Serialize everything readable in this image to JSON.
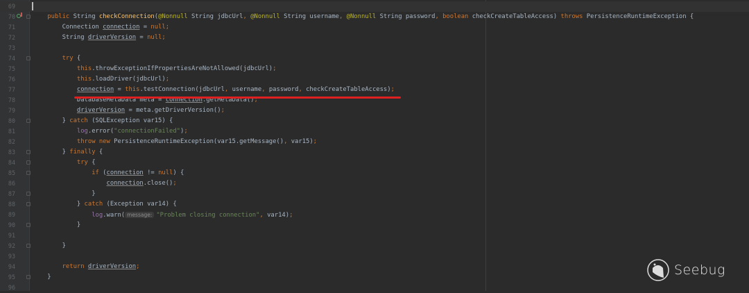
{
  "editor": {
    "current_line": 69,
    "colors": {
      "background": "#2b2b2b",
      "keyword": "#cc7832",
      "annotation": "#bbb529",
      "string": "#6a8759",
      "field": "#9876aa",
      "method_decl": "#ffc66d",
      "plain": "#a9b7c6",
      "highlight_underline": "#e02020"
    },
    "highlighted_line": 77,
    "lines": [
      {
        "n": "69",
        "tokens": []
      },
      {
        "n": "70",
        "fold": true,
        "tokens": [
          [
            "",
            "    "
          ],
          [
            "kw",
            "public "
          ],
          [
            "",
            "String "
          ],
          [
            "fn",
            "checkConnection"
          ],
          [
            "",
            "("
          ],
          [
            "ann",
            "@Nonnull "
          ],
          [
            "",
            "String jdbcUrl"
          ],
          [
            "kw",
            ", "
          ],
          [
            "ann",
            "@Nonnull "
          ],
          [
            "",
            "String username"
          ],
          [
            "kw",
            ", "
          ],
          [
            "ann",
            "@Nonnull "
          ],
          [
            "",
            "String password"
          ],
          [
            "kw",
            ", boolean "
          ],
          [
            "",
            "checkCreateTableAccess) "
          ],
          [
            "kw",
            "throws "
          ],
          [
            "",
            "PersistenceRuntimeException {"
          ]
        ]
      },
      {
        "n": "71",
        "tokens": [
          [
            "",
            "        Connection "
          ],
          [
            "u",
            "connection"
          ],
          [
            "",
            " = "
          ],
          [
            "kw",
            "null;"
          ]
        ]
      },
      {
        "n": "72",
        "tokens": [
          [
            "",
            "        String "
          ],
          [
            "u",
            "driverVersion"
          ],
          [
            "",
            " = "
          ],
          [
            "kw",
            "null;"
          ]
        ]
      },
      {
        "n": "73",
        "tokens": []
      },
      {
        "n": "74",
        "fold": true,
        "tokens": [
          [
            "kw",
            "        try "
          ],
          [
            "",
            "{"
          ]
        ]
      },
      {
        "n": "75",
        "tokens": [
          [
            "kw",
            "            this"
          ],
          [
            "",
            ".throwExceptionIfPropertiesAreNotAllowed(jdbcUrl)"
          ],
          [
            "kw",
            ";"
          ]
        ]
      },
      {
        "n": "76",
        "tokens": [
          [
            "kw",
            "            this"
          ],
          [
            "",
            ".loadDriver(jdbcUrl)"
          ],
          [
            "kw",
            ";"
          ]
        ]
      },
      {
        "n": "77",
        "tokens": [
          [
            "",
            "            "
          ],
          [
            "u",
            "connection"
          ],
          [
            "",
            " = "
          ],
          [
            "kw",
            "this"
          ],
          [
            "",
            ".testConnection(jdbcUrl"
          ],
          [
            "kw",
            ", "
          ],
          [
            "",
            "username"
          ],
          [
            "kw",
            ", "
          ],
          [
            "",
            "password"
          ],
          [
            "kw",
            ", "
          ],
          [
            "",
            "checkCreateTableAccess)"
          ],
          [
            "kw",
            ";"
          ]
        ]
      },
      {
        "n": "78",
        "tokens": [
          [
            "",
            "            DatabaseMetaData meta = "
          ],
          [
            "u",
            "connection"
          ],
          [
            "",
            ".getMetaData()"
          ],
          [
            "kw",
            ";"
          ]
        ]
      },
      {
        "n": "79",
        "tokens": [
          [
            "",
            "            "
          ],
          [
            "u",
            "driverVersion"
          ],
          [
            "",
            " = meta.getDriverVersion()"
          ],
          [
            "kw",
            ";"
          ]
        ]
      },
      {
        "n": "80",
        "fold": true,
        "tokens": [
          [
            "",
            "        } "
          ],
          [
            "kw",
            "catch "
          ],
          [
            "",
            "(SQLException var15) {"
          ]
        ]
      },
      {
        "n": "81",
        "tokens": [
          [
            "fld",
            "            log"
          ],
          [
            "",
            ".error("
          ],
          [
            "str",
            "\"connectionFailed\""
          ],
          [
            "",
            ")"
          ],
          [
            "kw",
            ";"
          ]
        ]
      },
      {
        "n": "82",
        "tokens": [
          [
            "kw",
            "            throw new "
          ],
          [
            "",
            "PersistenceRuntimeException(var15.getMessage()"
          ],
          [
            "kw",
            ", "
          ],
          [
            "",
            "var15)"
          ],
          [
            "kw",
            ";"
          ]
        ]
      },
      {
        "n": "83",
        "fold": true,
        "tokens": [
          [
            "",
            "        } "
          ],
          [
            "kw",
            "finally "
          ],
          [
            "",
            "{"
          ]
        ]
      },
      {
        "n": "84",
        "fold": true,
        "tokens": [
          [
            "kw",
            "            try "
          ],
          [
            "",
            "{"
          ]
        ]
      },
      {
        "n": "85",
        "fold": true,
        "tokens": [
          [
            "kw",
            "                if "
          ],
          [
            "",
            "("
          ],
          [
            "u",
            "connection"
          ],
          [
            "",
            " != "
          ],
          [
            "kw",
            "null"
          ],
          [
            "",
            ") {"
          ]
        ]
      },
      {
        "n": "86",
        "tokens": [
          [
            "",
            "                    "
          ],
          [
            "u",
            "connection"
          ],
          [
            "",
            ".close()"
          ],
          [
            "kw",
            ";"
          ]
        ]
      },
      {
        "n": "87",
        "fold": true,
        "tokens": [
          [
            "",
            "                }"
          ]
        ]
      },
      {
        "n": "88",
        "fold": true,
        "tokens": [
          [
            "",
            "            } "
          ],
          [
            "kw",
            "catch "
          ],
          [
            "",
            "(Exception var14) {"
          ]
        ]
      },
      {
        "n": "89",
        "tokens": [
          [
            "fld",
            "                log"
          ],
          [
            "",
            ".warn("
          ],
          [
            "hint",
            "message:"
          ],
          [
            "str",
            "\"Problem closing connection\""
          ],
          [
            "kw",
            ", "
          ],
          [
            "",
            "var14)"
          ],
          [
            "kw",
            ";"
          ]
        ]
      },
      {
        "n": "90",
        "fold": true,
        "tokens": [
          [
            "",
            "            }"
          ]
        ]
      },
      {
        "n": "91",
        "tokens": []
      },
      {
        "n": "92",
        "fold": true,
        "tokens": [
          [
            "",
            "        }"
          ]
        ]
      },
      {
        "n": "93",
        "tokens": []
      },
      {
        "n": "94",
        "tokens": [
          [
            "kw",
            "        return "
          ],
          [
            "u",
            "driverVersion"
          ],
          [
            "kw",
            ";"
          ]
        ]
      },
      {
        "n": "95",
        "fold": true,
        "tokens": [
          [
            "",
            "    }"
          ]
        ]
      },
      {
        "n": "96",
        "tokens": []
      }
    ]
  },
  "watermark": {
    "text": "Seebug"
  }
}
